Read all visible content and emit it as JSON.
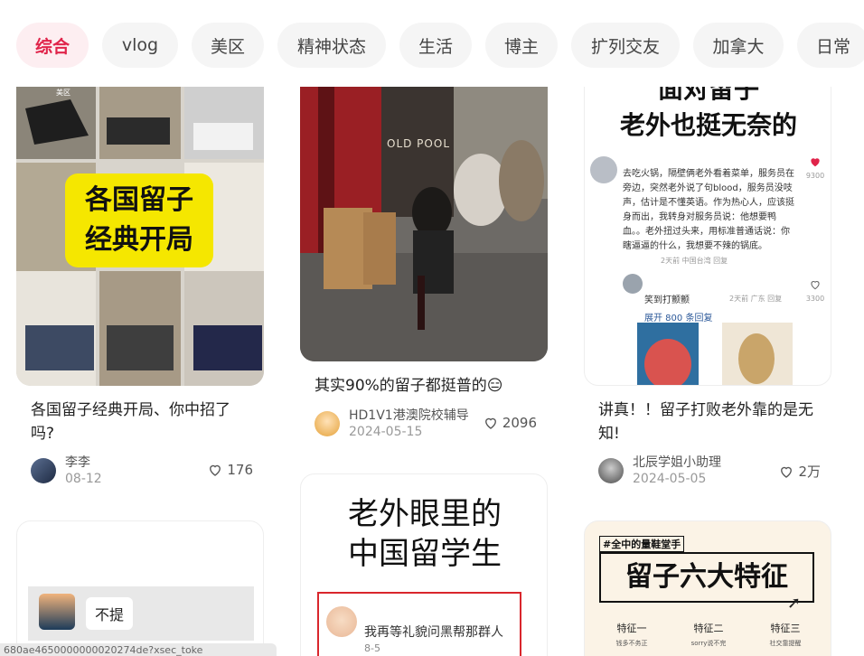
{
  "tabs": [
    {
      "label": "综合",
      "active": true
    },
    {
      "label": "vlog"
    },
    {
      "label": "美区"
    },
    {
      "label": "精神状态"
    },
    {
      "label": "生活"
    },
    {
      "label": "博主"
    },
    {
      "label": "扩列交友"
    },
    {
      "label": "加拿大"
    },
    {
      "label": "日常"
    }
  ],
  "cards": [
    {
      "cover_text": [
        "各国留子",
        "经典开局"
      ],
      "cover_tag": "美区",
      "title": "各国留子经典开局、你中招了吗?",
      "author": "李李",
      "date": "08-12",
      "likes": "176"
    },
    {
      "cover_text": [
        "OLD POOL"
      ],
      "title": "其实90%的留子都挺普的😑",
      "author": "HD1V1港澳院校辅导",
      "date": "2024-05-15",
      "likes": "2096"
    },
    {
      "cover_text": [
        "面对留子",
        "老外也挺无奈的"
      ],
      "comment1": "去吃火锅，隔壁俩老外看着菜单，服务员在旁边，突然老外说了句blood，服务员没吱声，估计是不懂英语。作为热心人，应该挺身而出，我转身对服务员说：他想要鸭血。。老外扭过头来，用标准普通话说：你瞎逼逼的什么，我想要不辣的锅底。",
      "comment1_meta": "2天前 中国台湾 回复",
      "comment1_likes": "9300",
      "comment2": "笑到打颤颤",
      "comment2_meta": "2天前 广东 回复",
      "comment2_likes": "3300",
      "expand": "展开 800 条回复",
      "title": "讲真！！留子打败老外靠的是无知!",
      "author": "北辰学姐小助理",
      "date": "2024-05-05",
      "likes": "2万"
    },
    {
      "cover_text": [
        "不提"
      ]
    },
    {
      "cover_text": [
        "老外眼里的",
        "中国留学生"
      ],
      "quote": "我再等礼貌问黑帮那群人",
      "quote_date": "8-5"
    },
    {
      "cover_text": [
        "#全中的量鞋堂手",
        "留子六大特征"
      ],
      "features": [
        "特征一",
        "特征二",
        "特征三"
      ],
      "feature_subs": [
        "钱多不务正",
        "sorry说不完",
        "社交靠提醒"
      ]
    }
  ],
  "status_url": "680ae4650000000020274de?xsec_toke",
  "colors": {
    "accent": "#e0244a",
    "tab_bg": "#f5f5f5"
  }
}
